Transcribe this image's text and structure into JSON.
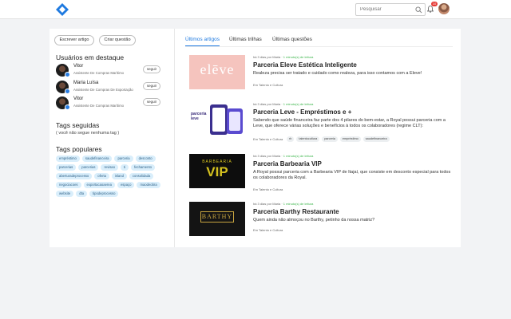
{
  "header": {
    "search_placeholder": "Pesquisar",
    "notification_count": "10"
  },
  "sidebar": {
    "write_article": "Escrever artigo",
    "create_question": "Criar questão",
    "featured_title": "Usuários em destaque",
    "users": [
      {
        "name": "Vitor",
        "role": "Assistente De Compras Marítimo",
        "follow": "seguir"
      },
      {
        "name": "Maria Luísa",
        "role": "Assistente De Compras De Exportação",
        "follow": "seguir"
      },
      {
        "name": "Vitor",
        "role": "Assistente De Compras Marítimo",
        "follow": "seguir"
      }
    ],
    "followed_tags_title": "Tags seguidas",
    "followed_tags_empty": "( você não segue nenhuma tag )",
    "popular_tags_title": "Tags populares",
    "popular_tags": [
      "empréstimo",
      "saudefinanceira",
      "parceria",
      "desconto",
      "parcerias",
      "parcerias",
      "revisao",
      "ti",
      "fechamento",
      "aberturadeprocesso",
      "oferta",
      "island",
      "consolidada",
      "negociacoes",
      "exportacaoaerea",
      "espaço",
      "maodeobra",
      "website",
      "dta",
      "tipodeprocesso"
    ]
  },
  "tabs": [
    "Últimos artigos",
    "Últimas trilhas",
    "Últimas questões"
  ],
  "articles": [
    {
      "meta_prefix": "há 3 dias por Maria · ",
      "read_time": "1 minuto(s) de leitura",
      "title": "Parceria Eleve Estética Inteligente",
      "description": "Realeza precisa ser tratado e cuidado como realeza, para isso contamos com a Eleve!",
      "category": "Em Talento e Cultura",
      "tags": [],
      "thumb_text": "elēve"
    },
    {
      "meta_prefix": "há 3 dias por Maria · ",
      "read_time": "1 minuto(s) de leitura",
      "title": "Parceria Leve - Empréstimos e +",
      "description": "Sabendo que saúde financeira faz parte dos 4 pilares do bem-estar, a Royal possui parceria com a Leve, que oferece várias soluções e benefícios à todos os colaboradores (regime CLT):",
      "category": "Em Talento e Cultura",
      "tags": [
        "rh",
        "talentocultura",
        "parceria",
        "empréstimo",
        "saudefinanceira"
      ],
      "thumb_text": "parceria leve"
    },
    {
      "meta_prefix": "há 3 dias por Maria · ",
      "read_time": "1 minuto(s) de leitura",
      "title": "Parceria Barbearia VIP",
      "description": "A Royal possui parceria com a Barbearia VIP de Itajaí, que consiste em desconto especial para todos os colaboradores da Royal.",
      "category": "Em Talento e Cultura",
      "tags": [],
      "thumb_text_top": "BARBEARIA",
      "thumb_text": "VIP"
    },
    {
      "meta_prefix": "há 3 dias por Maria · ",
      "read_time": "1 minuto(s) de leitura",
      "title": "Parceria Barthy Restaurante",
      "description": "Quem ainda não almoçou no Barthy, petinho da nossa matriz?",
      "category": "Em Talento e Cultura",
      "tags": [],
      "thumb_text": "BARTHY"
    }
  ],
  "colors": {
    "accent": "#1f7ae0",
    "tag_bg": "#d9eefb",
    "read_time": "#3bb54a"
  }
}
